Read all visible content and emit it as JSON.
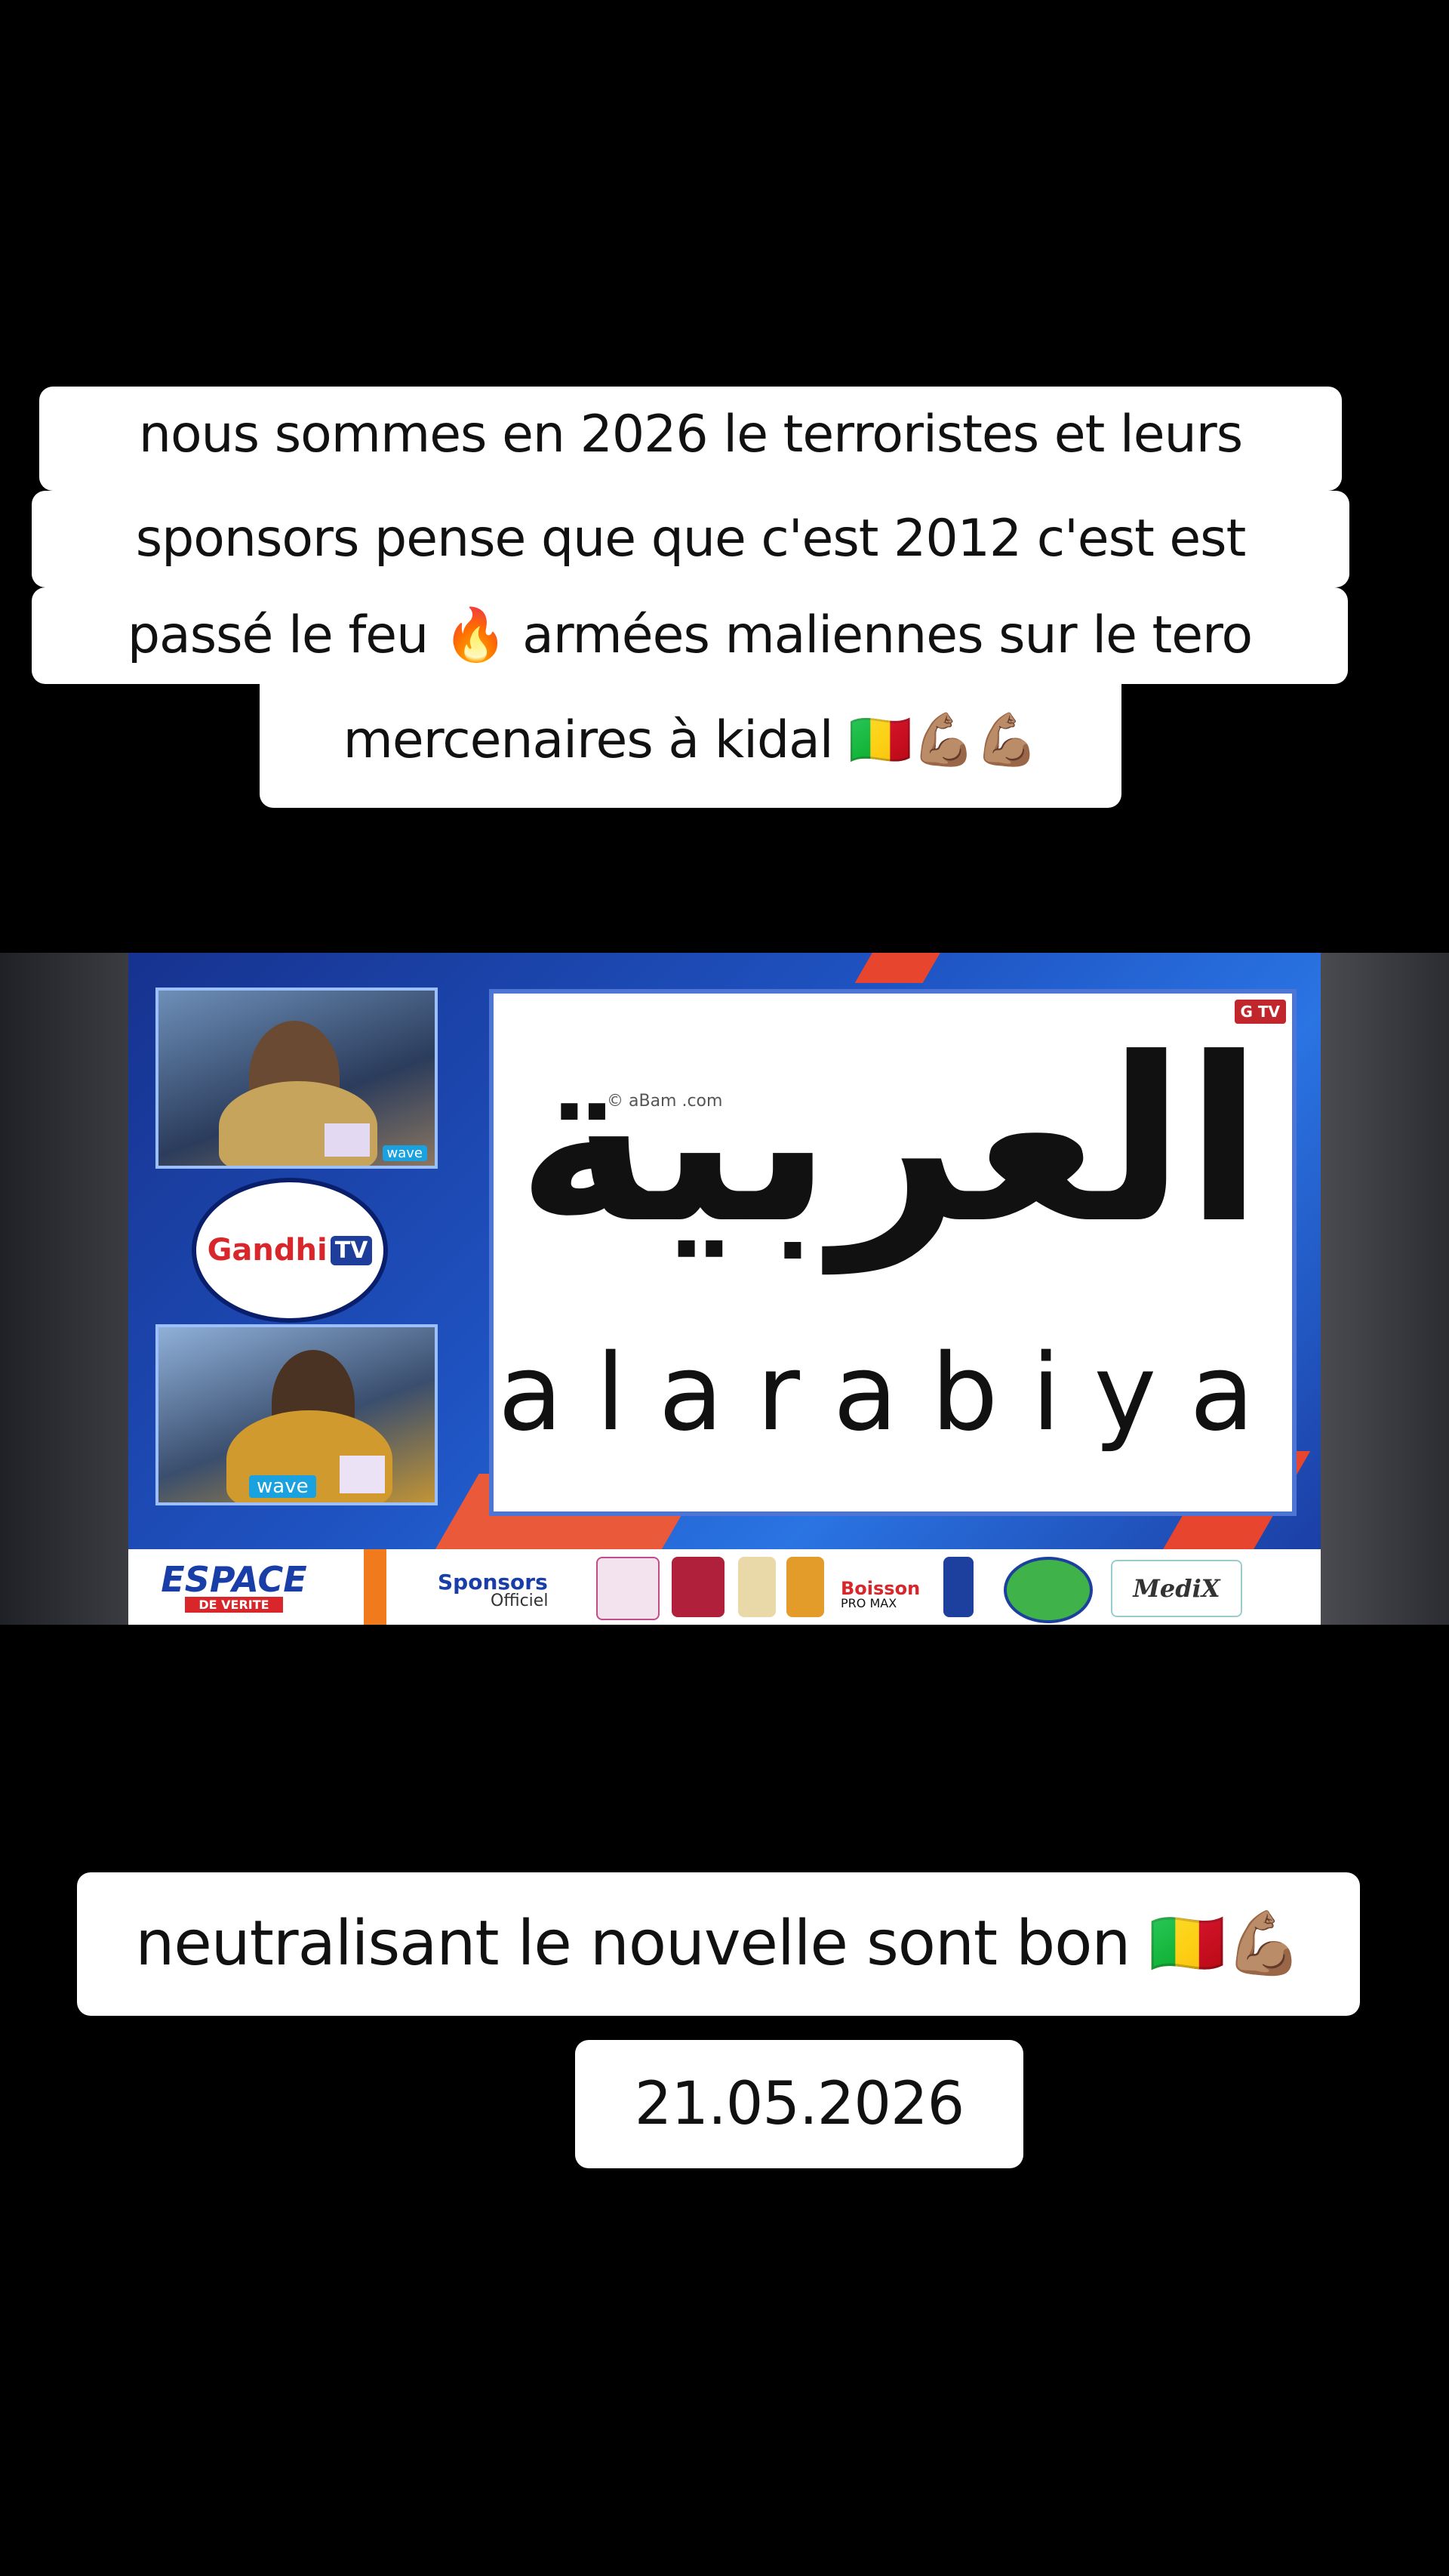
{
  "captions": {
    "line1": "nous sommes en 2026 le terroristes et leurs",
    "line2": "sponsors pense que que c'est 2012 c'est est",
    "line3": "passé le feu 🔥 armées maliennes sur le tero",
    "line4": "mercenaires à kidal 🇲🇱💪🏽💪🏽",
    "line5": "neutralisant le nouvelle sont bon 🇲🇱💪🏽",
    "date": "21.05.2026"
  },
  "video": {
    "arabic_logo": "العربية",
    "latin_logo": "alarabiya",
    "watermark": "© aBam      .com",
    "mini_logo": "G TV",
    "channel_logo_g": "Gandhi",
    "channel_logo_tv": "TV",
    "espace_title": "ESPACE",
    "espace_sub": "DE VERITE",
    "sponsors": "Sponsors",
    "sponsors_sub": "Officiel",
    "boisson": "Boisson",
    "boisson_sub": "PRO MAX",
    "medix": "MediX",
    "panel1_badge": "wave",
    "panel2_badge": "wave"
  }
}
